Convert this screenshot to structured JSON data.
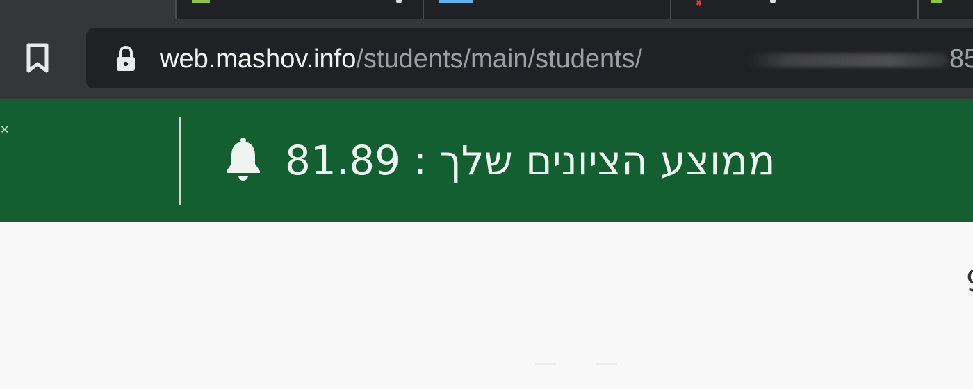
{
  "browser": {
    "url_host": "web.mashov.info",
    "url_path": "/students/main/students/",
    "url_tail": "85",
    "colors": {
      "chrome": "#35363a",
      "omnibox": "#202124"
    }
  },
  "banner": {
    "average_value": "81.89",
    "average_separator": ":",
    "average_label": "ממוצע הציונים שלך",
    "color": "#135f32"
  },
  "content": {
    "edge_char": "9"
  },
  "icons": {
    "bookmark": "bookmark-icon",
    "lock": "lock-icon",
    "bell": "bell-icon"
  }
}
